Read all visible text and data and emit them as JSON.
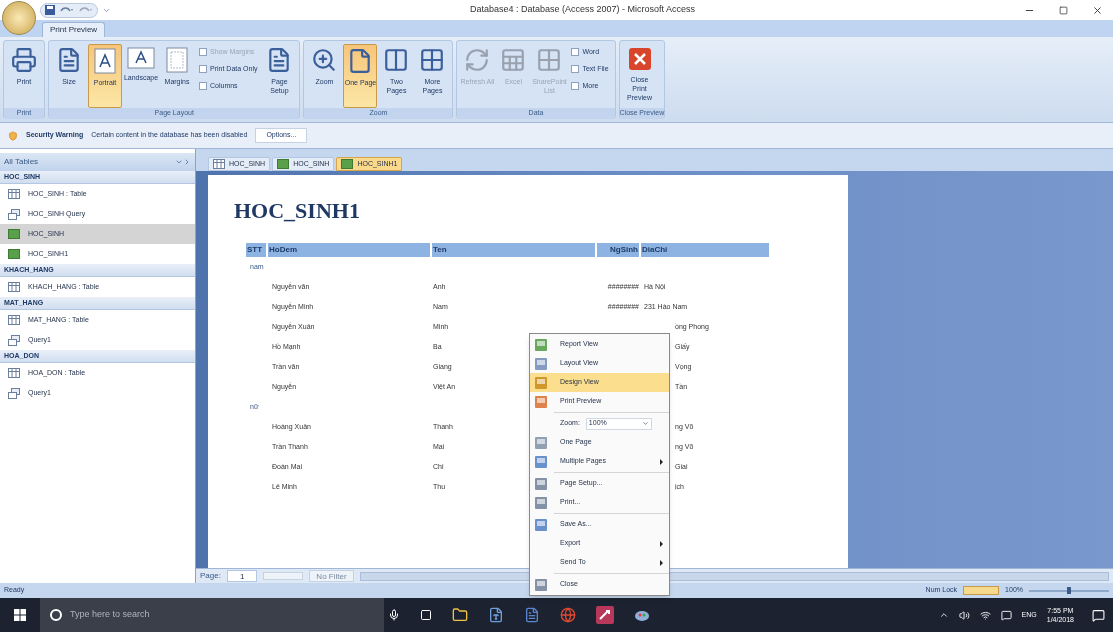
{
  "window": {
    "title": "Database4 : Database (Access 2007) - Microsoft Access"
  },
  "ribbon": {
    "tabs": [
      {
        "label": "Print Preview",
        "selected": true
      }
    ],
    "groups": [
      {
        "label": "Print",
        "items": [
          {
            "kind": "big",
            "label": "Print",
            "selected": false,
            "disabled": false
          }
        ]
      },
      {
        "label": "Page Layout",
        "items": [
          {
            "kind": "big",
            "label": "Size",
            "selected": false,
            "disabled": false
          },
          {
            "kind": "big",
            "label": "Portrait",
            "selected": true,
            "disabled": false
          },
          {
            "kind": "big",
            "label": "Landscape",
            "selected": false,
            "disabled": false
          },
          {
            "kind": "big",
            "label": "Margins",
            "selected": false,
            "disabled": false
          },
          {
            "kind": "checks",
            "items": [
              {
                "label": "Show Margins",
                "checked": false,
                "disabled": true
              },
              {
                "label": "Print Data Only",
                "checked": false,
                "disabled": false
              },
              {
                "label": "Columns",
                "checked": false,
                "disabled": false
              }
            ]
          },
          {
            "kind": "big",
            "label": "Page Setup",
            "selected": false,
            "disabled": false
          }
        ]
      },
      {
        "label": "Zoom",
        "items": [
          {
            "kind": "big",
            "label": "Zoom",
            "selected": false,
            "disabled": false
          },
          {
            "kind": "big",
            "label": "One Page",
            "selected": true,
            "disabled": false
          },
          {
            "kind": "big",
            "label": "Two Pages",
            "selected": false,
            "disabled": false
          },
          {
            "kind": "big",
            "label": "More Pages",
            "selected": false,
            "disabled": false
          }
        ]
      },
      {
        "label": "Data",
        "items": [
          {
            "kind": "big",
            "label": "Refresh All",
            "selected": false,
            "disabled": true
          },
          {
            "kind": "big",
            "label": "Excel",
            "selected": false,
            "disabled": true
          },
          {
            "kind": "big",
            "label": "SharePoint List",
            "selected": false,
            "disabled": true
          },
          {
            "kind": "smalls",
            "items": [
              {
                "label": "Word",
                "checked": false,
                "disabled": false
              },
              {
                "label": "Text File",
                "checked": false,
                "disabled": false
              },
              {
                "label": "More",
                "checked": false,
                "disabled": false
              }
            ]
          }
        ]
      },
      {
        "label": "Close Preview",
        "items": [
          {
            "kind": "big",
            "label": "Close Print Preview",
            "selected": false,
            "disabled": false
          }
        ]
      }
    ]
  },
  "security_bar": {
    "title": "Security Warning",
    "message": "Certain content in the database has been disabled",
    "button": "Options..."
  },
  "navigation": {
    "header": "All Tables",
    "groups": [
      {
        "label": "HOC_SINH",
        "items": [
          {
            "kind": "table",
            "label": "HOC_SINH : Table",
            "selected": false
          },
          {
            "kind": "query",
            "label": "HOC_SINH Query",
            "selected": false
          },
          {
            "kind": "report",
            "label": "HOC_SINH",
            "selected": true
          },
          {
            "kind": "report",
            "label": "HOC_SINH1",
            "selected": false
          }
        ]
      },
      {
        "label": "KHACH_HANG",
        "items": [
          {
            "kind": "table",
            "label": "KHACH_HANG : Table",
            "selected": false
          }
        ]
      },
      {
        "label": "MAT_HANG",
        "items": [
          {
            "kind": "table",
            "label": "MAT_HANG : Table",
            "selected": false
          },
          {
            "kind": "query",
            "label": "Query1",
            "selected": false
          }
        ]
      },
      {
        "label": "HOA_DON",
        "items": [
          {
            "kind": "table",
            "label": "HOA_DON : Table",
            "selected": false
          },
          {
            "kind": "query",
            "label": "Query1",
            "selected": false
          }
        ]
      }
    ]
  },
  "doc_tabs": [
    {
      "kind": "table",
      "label": "HOC_SINH",
      "selected": false
    },
    {
      "kind": "report",
      "label": "HOC_SINH",
      "selected": false
    },
    {
      "kind": "report",
      "label": "HOC_SINH1",
      "selected": true
    }
  ],
  "report": {
    "title": "HOC_SINH1",
    "columns": [
      "STT",
      "HoDem",
      "Ten",
      "NgSinh",
      "DiaChi"
    ],
    "groups": [
      {
        "label": "nam",
        "rows": [
          {
            "hodem": "Nguyễn văn",
            "ten": "Anh",
            "ngsinh": "########",
            "diachi": "Hà Nội"
          },
          {
            "hodem": "Nguyễn Minh",
            "ten": "Nam",
            "ngsinh": "########",
            "diachi": "231 Hào Nam"
          },
          {
            "hodem": "Nguyễn Xuân",
            "ten": "Minh",
            "diachi": "ồng Phong"
          },
          {
            "hodem": "Hồ Mạnh",
            "ten": "Ba",
            "diachi": "Giấy"
          },
          {
            "hodem": "Trần văn",
            "ten": "Giang",
            "diachi": "Vọng"
          },
          {
            "hodem": "Nguyễn",
            "ten": "Việt An",
            "diachi": "Tần"
          }
        ]
      },
      {
        "label": "nữ",
        "rows": [
          {
            "hodem": "Hoàng Xuân",
            "ten": "Thanh",
            "diachi": "ng Võ"
          },
          {
            "hodem": "Trần Thanh",
            "ten": "Mai",
            "diachi": "ng Võ"
          },
          {
            "hodem": "Đoàn Mai",
            "ten": "Chi",
            "diachi": "Giai"
          },
          {
            "hodem": "Lê Minh",
            "ten": "Thu",
            "diachi": "ịch"
          }
        ]
      }
    ]
  },
  "record_nav": {
    "label": "Page:",
    "value": "1",
    "filter": "No Filter"
  },
  "context_menu": [
    {
      "kind": "item",
      "label": "Report View",
      "selected": false,
      "submenu": false
    },
    {
      "kind": "item",
      "label": "Layout View",
      "selected": false,
      "submenu": false
    },
    {
      "kind": "item",
      "label": "Design View",
      "selected": true,
      "submenu": false
    },
    {
      "kind": "item",
      "label": "Print Preview",
      "selected": false,
      "submenu": false
    },
    {
      "kind": "separator"
    },
    {
      "kind": "zoom",
      "label": "Zoom:",
      "value": "100%"
    },
    {
      "kind": "item",
      "label": "One Page",
      "selected": false,
      "submenu": false
    },
    {
      "kind": "item",
      "label": "Multiple Pages",
      "selected": false,
      "submenu": true
    },
    {
      "kind": "separator"
    },
    {
      "kind": "item",
      "label": "Page Setup...",
      "selected": false,
      "submenu": false
    },
    {
      "kind": "item",
      "label": "Print...",
      "selected": false,
      "submenu": false
    },
    {
      "kind": "separator"
    },
    {
      "kind": "item",
      "label": "Save As...",
      "selected": false,
      "submenu": false
    },
    {
      "kind": "item",
      "label": "Export",
      "selected": false,
      "submenu": true
    },
    {
      "kind": "item",
      "label": "Send To",
      "selected": false,
      "submenu": true
    },
    {
      "kind": "separator"
    },
    {
      "kind": "item",
      "label": "Close",
      "selected": false,
      "submenu": false
    }
  ],
  "status_bar": {
    "left": "Ready",
    "num_lock": "Num Lock",
    "zoom": "100%",
    "zoom_slider": {
      "level": 0.5
    }
  },
  "taskbar": {
    "search_placeholder": "Type here to search",
    "language": "ENG",
    "time": "7:55 PM",
    "date": "1/4/2018"
  }
}
